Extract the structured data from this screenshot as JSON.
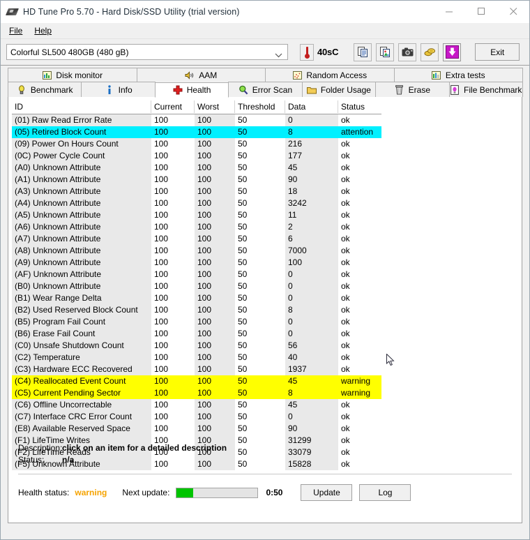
{
  "window": {
    "title": "HD Tune Pro 5.70 - Hard Disk/SSD Utility (trial version)",
    "minimize_label": "minimize",
    "maximize_label": "maximize",
    "close_label": "close"
  },
  "menu": {
    "items": [
      {
        "label": "File",
        "accel": "F"
      },
      {
        "label": "Help",
        "accel": "H"
      }
    ]
  },
  "toolbar": {
    "drive": "Colorful SL500 480GB (480 gB)",
    "temperature": "40°C",
    "temperature_raw": "40sC",
    "buttons": [
      {
        "name": "copy-text-button",
        "icon": "copy-text-icon"
      },
      {
        "name": "copy-image-button",
        "icon": "copy-image-icon"
      },
      {
        "name": "screenshot-button",
        "icon": "camera-icon"
      },
      {
        "name": "coins-button",
        "icon": "coins-icon"
      },
      {
        "name": "download-button",
        "icon": "download-arrow-icon"
      }
    ],
    "exit_label": "Exit"
  },
  "tabs": {
    "row1": [
      {
        "label": "Disk monitor",
        "icon": "bar-chart-icon",
        "active": false
      },
      {
        "label": "AAM",
        "icon": "speaker-icon",
        "active": false
      },
      {
        "label": "Random Access",
        "icon": "scatter-icon",
        "active": false
      },
      {
        "label": "Extra tests",
        "icon": "chart-grid-icon",
        "active": false
      }
    ],
    "row2": [
      {
        "label": "Benchmark",
        "icon": "lightbulb-icon",
        "active": false
      },
      {
        "label": "Info",
        "icon": "info-icon",
        "active": false
      },
      {
        "label": "Health",
        "icon": "red-cross-icon",
        "active": true
      },
      {
        "label": "Error Scan",
        "icon": "magnifier-icon",
        "active": false
      },
      {
        "label": "Folder Usage",
        "icon": "folder-icon",
        "active": false
      },
      {
        "label": "Erase",
        "icon": "trash-icon",
        "active": false
      },
      {
        "label": "File Benchmark",
        "icon": "file-bulb-icon",
        "active": false
      }
    ]
  },
  "table": {
    "columns": [
      "ID",
      "Current",
      "Worst",
      "Threshold",
      "Data",
      "Status"
    ],
    "rows": [
      {
        "id": "(01) Raw Read Error Rate",
        "current": "100",
        "worst": "100",
        "threshold": "50",
        "data": "0",
        "status": "ok",
        "highlight": "none"
      },
      {
        "id": "(05) Retired Block Count",
        "current": "100",
        "worst": "100",
        "threshold": "50",
        "data": "8",
        "status": "attention",
        "highlight": "attention"
      },
      {
        "id": "(09) Power On Hours Count",
        "current": "100",
        "worst": "100",
        "threshold": "50",
        "data": "216",
        "status": "ok",
        "highlight": "none"
      },
      {
        "id": "(0C) Power Cycle Count",
        "current": "100",
        "worst": "100",
        "threshold": "50",
        "data": "177",
        "status": "ok",
        "highlight": "none"
      },
      {
        "id": "(A0) Unknown Attribute",
        "current": "100",
        "worst": "100",
        "threshold": "50",
        "data": "45",
        "status": "ok",
        "highlight": "none"
      },
      {
        "id": "(A1) Unknown Attribute",
        "current": "100",
        "worst": "100",
        "threshold": "50",
        "data": "90",
        "status": "ok",
        "highlight": "none"
      },
      {
        "id": "(A3) Unknown Attribute",
        "current": "100",
        "worst": "100",
        "threshold": "50",
        "data": "18",
        "status": "ok",
        "highlight": "none"
      },
      {
        "id": "(A4) Unknown Attribute",
        "current": "100",
        "worst": "100",
        "threshold": "50",
        "data": "3242",
        "status": "ok",
        "highlight": "none"
      },
      {
        "id": "(A5) Unknown Attribute",
        "current": "100",
        "worst": "100",
        "threshold": "50",
        "data": "11",
        "status": "ok",
        "highlight": "none"
      },
      {
        "id": "(A6) Unknown Attribute",
        "current": "100",
        "worst": "100",
        "threshold": "50",
        "data": "2",
        "status": "ok",
        "highlight": "none"
      },
      {
        "id": "(A7) Unknown Attribute",
        "current": "100",
        "worst": "100",
        "threshold": "50",
        "data": "6",
        "status": "ok",
        "highlight": "none"
      },
      {
        "id": "(A8) Unknown Attribute",
        "current": "100",
        "worst": "100",
        "threshold": "50",
        "data": "7000",
        "status": "ok",
        "highlight": "none"
      },
      {
        "id": "(A9) Unknown Attribute",
        "current": "100",
        "worst": "100",
        "threshold": "50",
        "data": "100",
        "status": "ok",
        "highlight": "none"
      },
      {
        "id": "(AF) Unknown Attribute",
        "current": "100",
        "worst": "100",
        "threshold": "50",
        "data": "0",
        "status": "ok",
        "highlight": "none"
      },
      {
        "id": "(B0) Unknown Attribute",
        "current": "100",
        "worst": "100",
        "threshold": "50",
        "data": "0",
        "status": "ok",
        "highlight": "none"
      },
      {
        "id": "(B1) Wear Range Delta",
        "current": "100",
        "worst": "100",
        "threshold": "50",
        "data": "0",
        "status": "ok",
        "highlight": "none"
      },
      {
        "id": "(B2) Used Reserved Block Count",
        "current": "100",
        "worst": "100",
        "threshold": "50",
        "data": "8",
        "status": "ok",
        "highlight": "none"
      },
      {
        "id": "(B5) Program Fail Count",
        "current": "100",
        "worst": "100",
        "threshold": "50",
        "data": "0",
        "status": "ok",
        "highlight": "none"
      },
      {
        "id": "(B6) Erase Fail Count",
        "current": "100",
        "worst": "100",
        "threshold": "50",
        "data": "0",
        "status": "ok",
        "highlight": "none"
      },
      {
        "id": "(C0) Unsafe Shutdown Count",
        "current": "100",
        "worst": "100",
        "threshold": "50",
        "data": "56",
        "status": "ok",
        "highlight": "none"
      },
      {
        "id": "(C2) Temperature",
        "current": "100",
        "worst": "100",
        "threshold": "50",
        "data": "40",
        "status": "ok",
        "highlight": "none"
      },
      {
        "id": "(C3) Hardware ECC Recovered",
        "current": "100",
        "worst": "100",
        "threshold": "50",
        "data": "1937",
        "status": "ok",
        "highlight": "none"
      },
      {
        "id": "(C4) Reallocated Event Count",
        "current": "100",
        "worst": "100",
        "threshold": "50",
        "data": "45",
        "status": "warning",
        "highlight": "warning"
      },
      {
        "id": "(C5) Current Pending Sector",
        "current": "100",
        "worst": "100",
        "threshold": "50",
        "data": "8",
        "status": "warning",
        "highlight": "warning"
      },
      {
        "id": "(C6) Offline Uncorrectable",
        "current": "100",
        "worst": "100",
        "threshold": "50",
        "data": "45",
        "status": "ok",
        "highlight": "none"
      },
      {
        "id": "(C7) Interface CRC Error Count",
        "current": "100",
        "worst": "100",
        "threshold": "50",
        "data": "0",
        "status": "ok",
        "highlight": "none"
      },
      {
        "id": "(E8) Available Reserved Space",
        "current": "100",
        "worst": "100",
        "threshold": "50",
        "data": "90",
        "status": "ok",
        "highlight": "none"
      },
      {
        "id": "(F1) LifeTime Writes",
        "current": "100",
        "worst": "100",
        "threshold": "50",
        "data": "31299",
        "status": "ok",
        "highlight": "none"
      },
      {
        "id": "(F2) LifeTime Reads",
        "current": "100",
        "worst": "100",
        "threshold": "50",
        "data": "33079",
        "status": "ok",
        "highlight": "none"
      },
      {
        "id": "(F5) Unknown Attribute",
        "current": "100",
        "worst": "100",
        "threshold": "50",
        "data": "15828",
        "status": "ok",
        "highlight": "none"
      }
    ]
  },
  "details": {
    "description_label": "Description:",
    "description_value": "click on an item for a detailed description",
    "status_label": "Status:",
    "status_value": "n/a"
  },
  "footer": {
    "health_status_label": "Health status:",
    "health_status_value": "warning",
    "next_update_label": "Next update:",
    "next_update_time": "0:50",
    "progress_percent": 20,
    "update_button": "Update",
    "log_button": "Log"
  },
  "colors": {
    "attention": "#00f0ff",
    "warning_row": "#ffff00",
    "warning_text": "#f5a300",
    "progress": "#00c400",
    "window_bg": "#f0f0f0"
  }
}
